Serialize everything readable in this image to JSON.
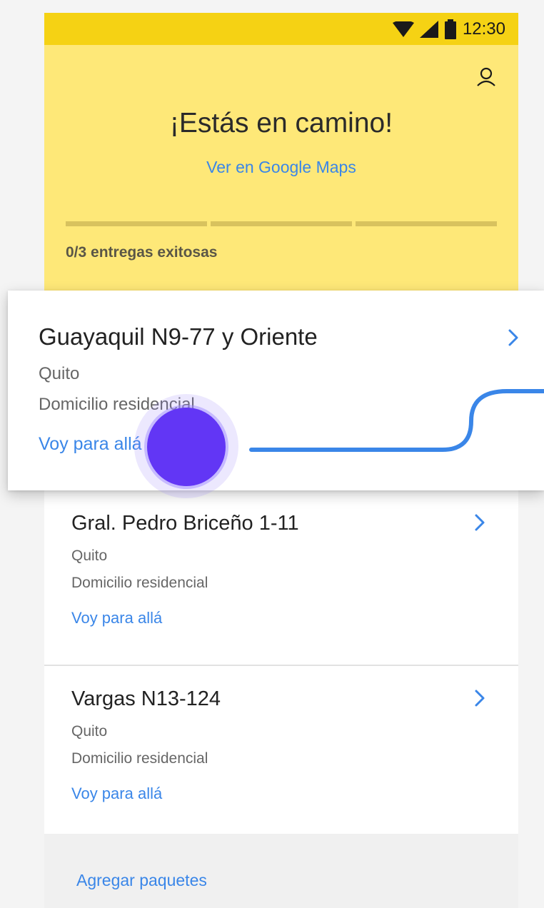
{
  "status_bar": {
    "time": "12:30",
    "icons": [
      "wifi-icon",
      "signal-icon",
      "battery-icon"
    ]
  },
  "header": {
    "title": "¡Estás en camino!",
    "maps_link": "Ver en Google Maps",
    "progress": {
      "completed": 0,
      "total": 3
    },
    "progress_label": "0/3 entregas exitosas"
  },
  "deliveries": [
    {
      "address": "Guayaquil N9-77 y Oriente",
      "city": "Quito",
      "type": "Domicilio residencial",
      "action": "Voy para allá"
    },
    {
      "address": "Gral. Pedro Briceño 1-11",
      "city": "Quito",
      "type": "Domicilio residencial",
      "action": "Voy para allá"
    },
    {
      "address": "Vargas N13-124",
      "city": "Quito",
      "type": "Domicilio residencial",
      "action": "Voy para allá"
    }
  ],
  "footer": {
    "add_label": "Agregar paquetes"
  },
  "colors": {
    "status_bar": "#f5d214",
    "header": "#fee878",
    "link": "#3a86e8",
    "touch": "#6236f5",
    "swipe": "#3a86e8"
  }
}
